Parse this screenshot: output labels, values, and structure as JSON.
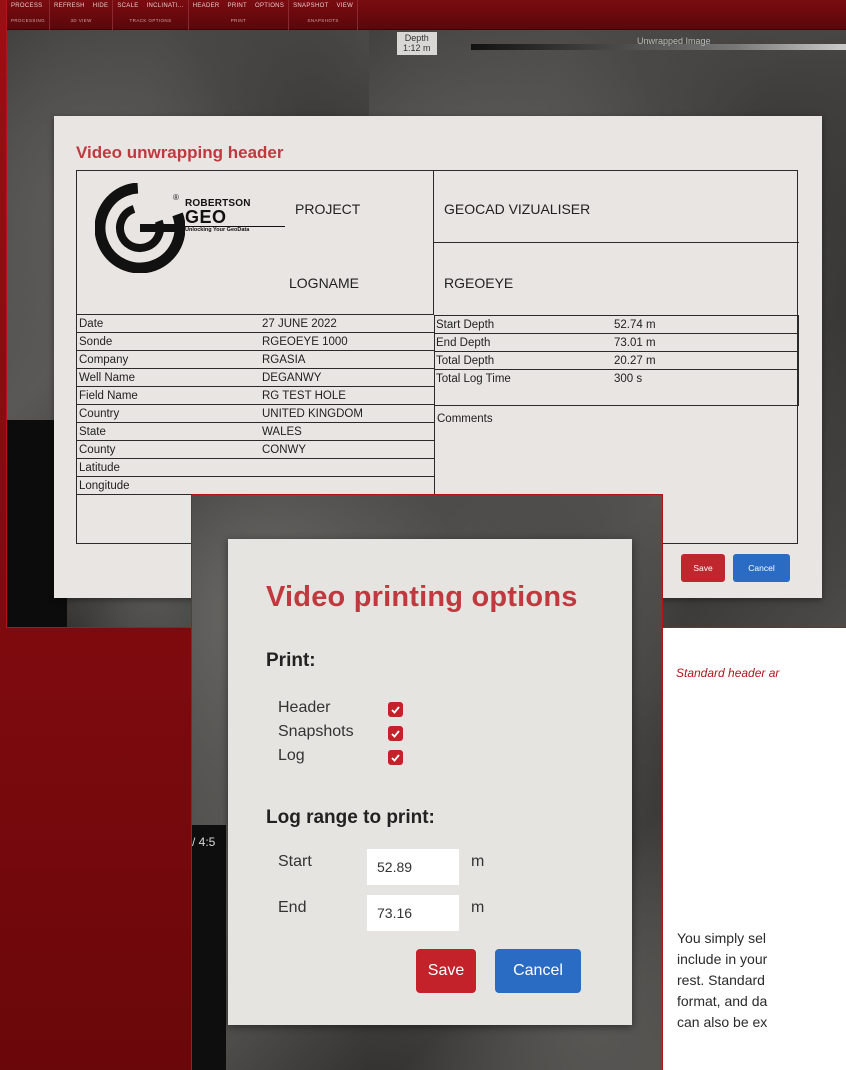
{
  "toolbar": {
    "groups": [
      {
        "buttons": [
          "PROCESS"
        ],
        "sub": "PROCESSING"
      },
      {
        "buttons": [
          "REFRESH",
          "HIDE"
        ],
        "sub": "3D VIEW"
      },
      {
        "buttons": [
          "SCALE",
          "INCLINATI..."
        ],
        "sub": "TRACK OPTIONS"
      },
      {
        "buttons": [
          "HEADER",
          "PRINT",
          "OPTIONS"
        ],
        "sub": "PRINT"
      },
      {
        "buttons": [
          "SNAPSHOT",
          "VIEW"
        ],
        "sub": "SNAPSHOTS"
      }
    ]
  },
  "viewer": {
    "depth_label": "Depth",
    "depth_scale": "1:12 m",
    "unwrapped_label": "Unwrapped Image",
    "time_text": "/ 4:5"
  },
  "header_dialog": {
    "title": "Video unwrapping header",
    "logo": {
      "registered": "®",
      "brand_line1": "ROBERTSON",
      "brand_line2": "GEO",
      "tagline": "Unlocking Your GeoData"
    },
    "project_label": "PROJECT",
    "project_value": "GEOCAD VIZUALISER",
    "logname_label": "LOGNAME",
    "logname_value": "RGEOEYE",
    "left_rows": [
      {
        "key": "Date",
        "value": "27 JUNE 2022"
      },
      {
        "key": "Sonde",
        "value": "RGEOEYE 1000"
      },
      {
        "key": "Company",
        "value": "RGASIA"
      },
      {
        "key": "Well Name",
        "value": "DEGANWY"
      },
      {
        "key": "Field Name",
        "value": "RG TEST HOLE"
      },
      {
        "key": "Country",
        "value": "UNITED KINGDOM"
      },
      {
        "key": "State",
        "value": "WALES"
      },
      {
        "key": "County",
        "value": "CONWY"
      },
      {
        "key": "Latitude",
        "value": ""
      },
      {
        "key": "Longitude",
        "value": ""
      }
    ],
    "right_rows": [
      {
        "key": "Start Depth",
        "value": "52.74 m"
      },
      {
        "key": "End Depth",
        "value": "73.01 m"
      },
      {
        "key": "Total Depth",
        "value": "20.27 m"
      },
      {
        "key": "Total Log Time",
        "value": "300 s"
      }
    ],
    "comments_label": "Comments",
    "save_label": "Save",
    "cancel_label": "Cancel"
  },
  "print_dialog": {
    "title": "Video printing options",
    "print_heading": "Print:",
    "options": [
      {
        "label": "Header",
        "checked": true
      },
      {
        "label": "Snapshots",
        "checked": true
      },
      {
        "label": "Log",
        "checked": true
      }
    ],
    "range_heading": "Log range to print:",
    "start_label": "Start",
    "start_value": "52.89",
    "end_label": "End",
    "end_value": "73.16",
    "unit": "m",
    "save_label": "Save",
    "cancel_label": "Cancel"
  },
  "page": {
    "caption": "Standard header ar",
    "body_lines": [
      "You simply sel",
      "include in your",
      "rest. Standard",
      "format, and da",
      "can also be ex"
    ]
  },
  "colors": {
    "brand_red": "#c0393f",
    "button_red": "#c4222b",
    "button_blue": "#2a6cc4",
    "band_red": "#9a0f14"
  }
}
